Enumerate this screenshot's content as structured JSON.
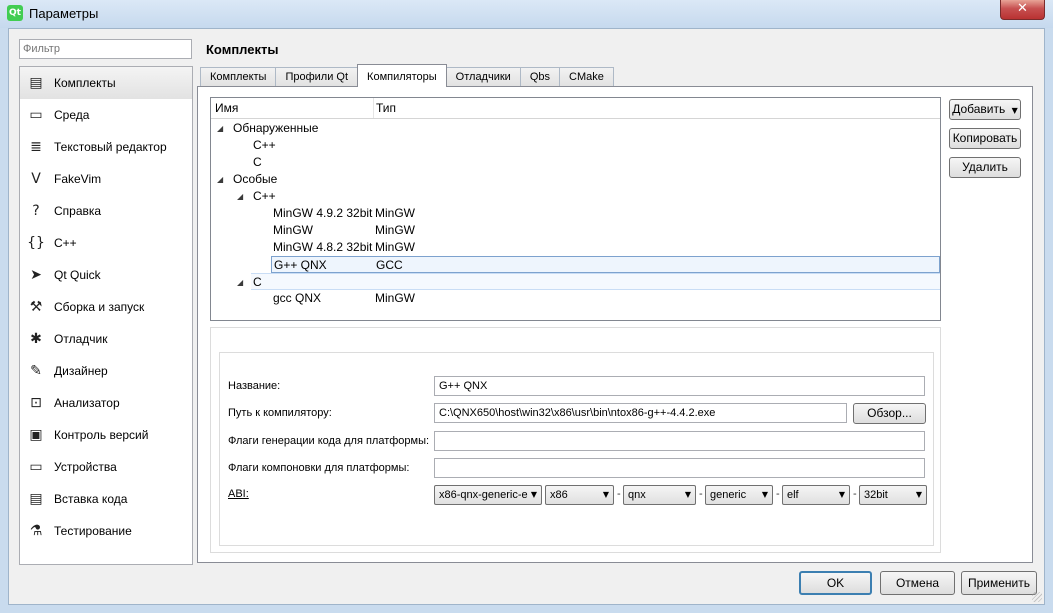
{
  "window": {
    "title": "Параметры",
    "close_glyph": "✕",
    "app_icon": "qt-creator-icon"
  },
  "filter": {
    "placeholder": "Фильтр"
  },
  "sidebar": {
    "items": [
      {
        "label": "Комплекты",
        "icon": "kits-icon",
        "glyph": "▤",
        "selected": true
      },
      {
        "label": "Среда",
        "icon": "monitor-icon",
        "glyph": "▭"
      },
      {
        "label": "Текстовый редактор",
        "icon": "text-editor-icon",
        "glyph": "≣"
      },
      {
        "label": "FakeVim",
        "icon": "fakevim-icon",
        "glyph": "V"
      },
      {
        "label": "Справка",
        "icon": "help-icon",
        "glyph": "?"
      },
      {
        "label": "C++",
        "icon": "cpp-braces-icon",
        "glyph": "{}"
      },
      {
        "label": "Qt Quick",
        "icon": "qt-quick-icon",
        "glyph": "➤"
      },
      {
        "label": "Сборка и запуск",
        "icon": "hammer-icon",
        "glyph": "⚒"
      },
      {
        "label": "Отладчик",
        "icon": "bug-icon",
        "glyph": "✱"
      },
      {
        "label": "Дизайнер",
        "icon": "pencil-icon",
        "glyph": "✎"
      },
      {
        "label": "Анализатор",
        "icon": "analyzer-icon",
        "glyph": "⊡"
      },
      {
        "label": "Контроль версий",
        "icon": "version-control-icon",
        "glyph": "▣"
      },
      {
        "label": "Устройства",
        "icon": "devices-icon",
        "glyph": "▭"
      },
      {
        "label": "Вставка кода",
        "icon": "code-paste-icon",
        "glyph": "▤"
      },
      {
        "label": "Тестирование",
        "icon": "testing-flask-icon",
        "glyph": "⚗"
      }
    ]
  },
  "page": {
    "title": "Комплекты"
  },
  "tabs": [
    {
      "label": "Комплекты",
      "active": false
    },
    {
      "label": "Профили Qt",
      "active": false
    },
    {
      "label": "Компиляторы",
      "active": true
    },
    {
      "label": "Отладчики",
      "active": false
    },
    {
      "label": "Qbs",
      "active": false
    },
    {
      "label": "CMake",
      "active": false
    }
  ],
  "tree": {
    "columns": [
      "Имя",
      "Тип"
    ],
    "rows": [
      {
        "name": "Обнаруженные",
        "type": "",
        "level": 0,
        "expanded": true
      },
      {
        "name": "C++",
        "type": "",
        "level": 1
      },
      {
        "name": "C",
        "type": "",
        "level": 1
      },
      {
        "name": "Особые",
        "type": "",
        "level": 0,
        "expanded": true
      },
      {
        "name": "C++",
        "type": "",
        "level": 1,
        "expanded": true
      },
      {
        "name": "MinGW 4.9.2 32bit",
        "type": "MinGW",
        "level": 2
      },
      {
        "name": "MinGW",
        "type": "MinGW",
        "level": 2
      },
      {
        "name": "MinGW 4.8.2 32bit",
        "type": "MinGW",
        "level": 2
      },
      {
        "name": "G++ QNX",
        "type": "GCC",
        "level": 2,
        "selected": true
      },
      {
        "name": "C",
        "type": "",
        "level": 1,
        "expanded": true,
        "hover": true
      },
      {
        "name": "gcc QNX",
        "type": "MinGW",
        "level": 2
      }
    ]
  },
  "actions": {
    "add": "Добавить",
    "add_caret": "▼",
    "copy": "Копировать",
    "remove": "Удалить"
  },
  "form": {
    "name_label": "Название:",
    "name_value": "G++ QNX",
    "path_label": "Путь к компилятору:",
    "path_value": "C:\\QNX650\\host\\win32\\x86\\usr\\bin\\ntox86-g++-4.4.2.exe",
    "browse": "Обзор...",
    "cflags_label": "Флаги генерации кода для платформы:",
    "cflags_value": "",
    "lflags_label": "Флаги компоновки для платформы:",
    "lflags_value": "",
    "abi_label": "ABI:",
    "abi": [
      "x86-qnx-generic-e",
      "x86",
      "qnx",
      "generic",
      "elf",
      "32bit"
    ],
    "abi_sep": "-"
  },
  "footer": {
    "ok": "OK",
    "cancel": "Отмена",
    "apply": "Применить"
  }
}
